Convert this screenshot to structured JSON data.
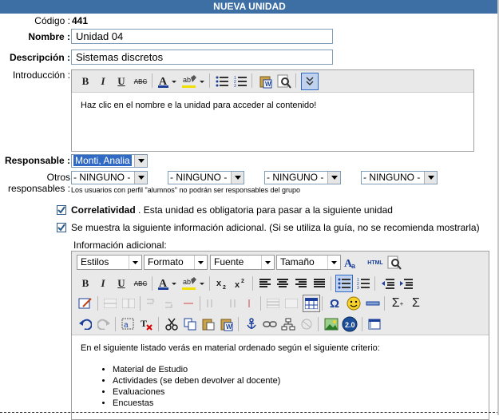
{
  "header": {
    "title": "NUEVA UNIDAD"
  },
  "codigo": {
    "label": "Código :",
    "value": "441"
  },
  "nombre": {
    "label": "Nombre :",
    "value": "Unidad 04"
  },
  "descripcion": {
    "label": "Descripción :",
    "value": "Sistemas discretos"
  },
  "introduccion": {
    "label": "Introducción :",
    "content": "Haz clic en el nombre e la unidad para acceder al contenido!"
  },
  "responsable": {
    "label": "Responsable :",
    "value": "Monti, Analia"
  },
  "otros": {
    "label_line1": "Otros",
    "label_line2": "responsables :",
    "options": [
      "- NINGUNO -",
      "- NINGUNO -",
      "- NINGUNO -",
      "- NINGUNO -"
    ],
    "note": "Los usuarios con perfil \"alumnos\" no podrán ser responsables del grupo"
  },
  "correlatividad": {
    "checked": true,
    "bold": "Correlatividad",
    "text": ". Esta unidad es obligatoria para pasar a la siguiente unidad"
  },
  "info_adicional_check": {
    "checked": true,
    "text": "Se muestra la siguiente información adicional. (Si se utiliza la guía, no se recomienda mostrarla)"
  },
  "info_adicional": {
    "label": "Información adicional:",
    "combos": {
      "style": "Estilos",
      "format": "Formato",
      "font": "Fuente",
      "size": "Tamaño"
    },
    "html_label": "HTML",
    "intro_text": "En el siguiente listado verás en material ordenado según el siguiente criterio:",
    "list": [
      "Material de Estudio",
      "Actividades (se deben devolver al docente)",
      "Evaluaciones",
      "Encuestas"
    ]
  },
  "colors": {
    "header_bg": "#3d6fa5",
    "selected_bg": "#316ac5",
    "check_color": "#2b5a8a"
  }
}
